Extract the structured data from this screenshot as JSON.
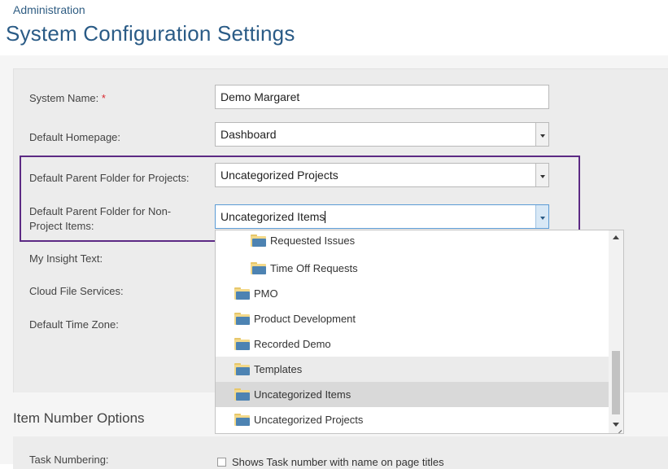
{
  "breadcrumb": "Administration",
  "title": "System Configuration Settings",
  "fields": {
    "system_name_label": "System Name:",
    "required_mark": "*",
    "system_name_value": "Demo Margaret",
    "homepage_label": "Default Homepage:",
    "homepage_value": "Dashboard",
    "parent_projects_label": "Default Parent Folder for Projects:",
    "parent_projects_value": "Uncategorized Projects",
    "parent_nonproject_label_line1": "Default Parent Folder for Non-",
    "parent_nonproject_label_line2": "Project Items:",
    "parent_nonproject_value": "Uncategorized Items",
    "insight_label": "My Insight Text:",
    "cloud_label": "Cloud File Services:",
    "timezone_label": "Default Time Zone:"
  },
  "dropdown": {
    "options": [
      {
        "label": "Requested Issues",
        "indent": 1,
        "state": "normal"
      },
      {
        "label": "Time Off Requests",
        "indent": 1,
        "state": "normal"
      },
      {
        "label": "PMO",
        "indent": 0,
        "state": "normal"
      },
      {
        "label": "Product Development",
        "indent": 0,
        "state": "normal"
      },
      {
        "label": "Recorded Demo",
        "indent": 0,
        "state": "normal"
      },
      {
        "label": "Templates",
        "indent": 0,
        "state": "hover"
      },
      {
        "label": "Uncategorized Items",
        "indent": 0,
        "state": "selected"
      },
      {
        "label": "Uncategorized Projects",
        "indent": 0,
        "state": "normal"
      }
    ]
  },
  "item_number": {
    "section_title": "Item Number Options",
    "task_numbering_label": "Task Numbering:",
    "checkbox_label": "Shows Task number with name on page titles"
  },
  "colors": {
    "title": "#2a5b86",
    "highlight_border": "#5c2a84",
    "folder_blue": "#4d83b2",
    "folder_yellow": "#f3d98a"
  }
}
